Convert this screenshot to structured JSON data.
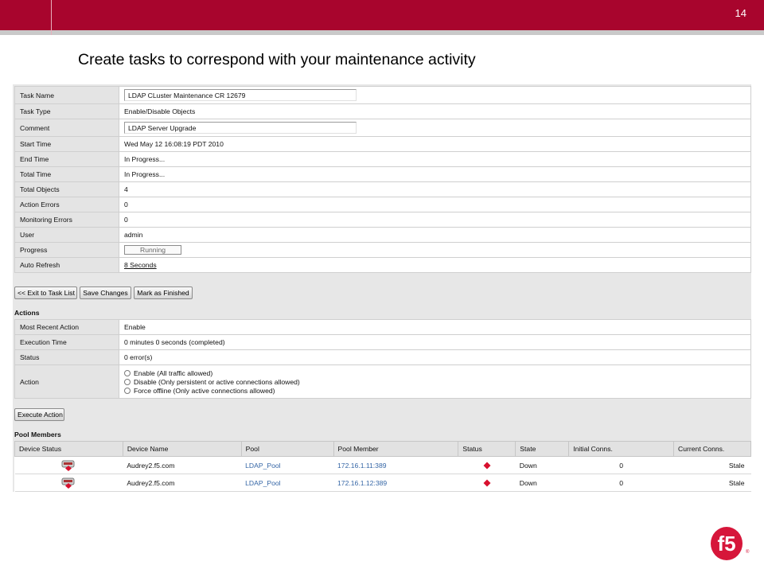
{
  "slide": {
    "number": "14",
    "title": "Create tasks to correspond with your maintenance activity"
  },
  "colors": {
    "brand": "#a8052d",
    "status_down": "#d8102e",
    "link": "#3566a6"
  },
  "task_properties": [
    {
      "key": "task_name",
      "label": "Task Name",
      "value": "LDAP CLuster Maintenance CR 12679",
      "kind": "input"
    },
    {
      "key": "task_type",
      "label": "Task Type",
      "value": "Enable/Disable Objects",
      "kind": "text"
    },
    {
      "key": "comment",
      "label": "Comment",
      "value": "LDAP Server Upgrade",
      "kind": "input"
    },
    {
      "key": "start_time",
      "label": "Start Time",
      "value": "Wed May 12 16:08:19 PDT 2010",
      "kind": "text"
    },
    {
      "key": "end_time",
      "label": "End Time",
      "value": "In Progress...",
      "kind": "text"
    },
    {
      "key": "total_time",
      "label": "Total Time",
      "value": "In Progress...",
      "kind": "text"
    },
    {
      "key": "total_objects",
      "label": "Total Objects",
      "value": "4",
      "kind": "text"
    },
    {
      "key": "action_errors",
      "label": "Action Errors",
      "value": "0",
      "kind": "text"
    },
    {
      "key": "monitoring_errors",
      "label": "Monitoring Errors",
      "value": "0",
      "kind": "text"
    },
    {
      "key": "user",
      "label": "User",
      "value": "admin",
      "kind": "text"
    },
    {
      "key": "progress",
      "label": "Progress",
      "value": "Running",
      "kind": "progress"
    },
    {
      "key": "auto_refresh",
      "label": "Auto Refresh",
      "value": "8 Seconds",
      "kind": "link"
    }
  ],
  "buttons": {
    "exit": "<< Exit to Task List",
    "save": "Save Changes",
    "finish": "Mark as Finished",
    "execute": "Execute Action"
  },
  "actions": {
    "heading": "Actions",
    "most_recent_label": "Most Recent Action",
    "most_recent_value": "Enable",
    "exec_time_label": "Execution Time",
    "exec_time_value": "0 minutes 0 seconds (completed)",
    "status_label": "Status",
    "status_value": "0 error(s)",
    "action_label": "Action",
    "options": [
      "Enable (All traffic allowed)",
      "Disable (Only persistent or active connections allowed)",
      "Force offline (Only active connections allowed)"
    ]
  },
  "pool_members": {
    "heading": "Pool Members",
    "columns": [
      "Device Status",
      "Device Name",
      "Pool",
      "Pool Member",
      "Status",
      "State",
      "Initial Conns.",
      "Current Conns."
    ],
    "rows": [
      {
        "device_icon": "device-warning-icon",
        "device_name": "Audrey2.f5.com",
        "pool": "LDAP_Pool",
        "member": "172.16.1.11:389",
        "status_icon": "red-diamond-icon",
        "state": "Down",
        "initial": "0",
        "current": "Stale"
      },
      {
        "device_icon": "device-warning-icon",
        "device_name": "Audrey2.f5.com",
        "pool": "LDAP_Pool",
        "member": "172.16.1.12:389",
        "status_icon": "red-diamond-icon",
        "state": "Down",
        "initial": "0",
        "current": "Stale"
      }
    ]
  },
  "logo": {
    "text": "f5",
    "icon": "f5-logo-icon"
  }
}
